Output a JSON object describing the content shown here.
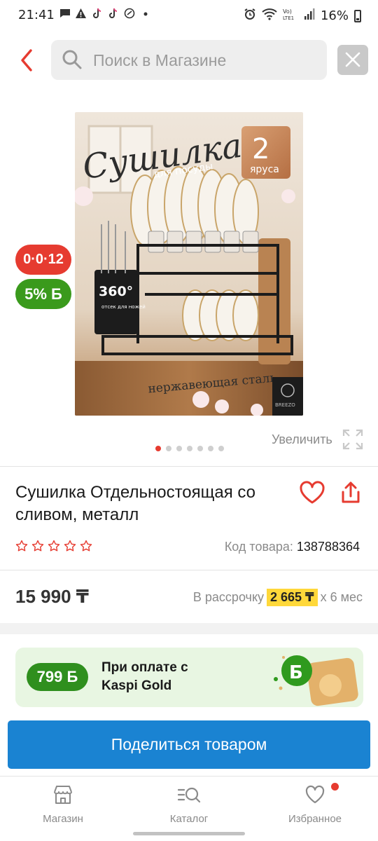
{
  "status_bar": {
    "time": "21:41",
    "battery": "16%",
    "notification_icons": [
      "chat-icon",
      "warning-icon",
      "tiktok-icon",
      "tiktok-icon",
      "sync-icon",
      "dot-icon"
    ],
    "system_icons": [
      "alarm-icon",
      "wifi-icon",
      "volte-icon",
      "signal-icon",
      "battery-icon"
    ]
  },
  "search": {
    "placeholder": "Поиск в Магазине"
  },
  "product_image": {
    "heading": "Сушилка",
    "subheading": "для посуды",
    "tier_badge_number": "2",
    "tier_badge_text": "яруса",
    "caption": "нержавеющая сталь",
    "rotate_label": "360°",
    "rotate_sub": "отсек для ножей",
    "brand": "BREEZO"
  },
  "badges": {
    "installment": "0·0·12",
    "bonus": "5% Б"
  },
  "gallery": {
    "zoom_label": "Увеличить",
    "dot_count": 7,
    "active_dot": 0
  },
  "product": {
    "title": "Сушилка Отдельностоящая со сливом, металл",
    "rating_stars": 0,
    "code_label": "Код товара:",
    "code_value": "138788364"
  },
  "pricing": {
    "price": "15 990 ₸",
    "installment_prefix": "В рассрочку",
    "installment_amount": "2 665 ₸",
    "installment_suffix": "х 6 мес"
  },
  "promo": {
    "bonus": "799 Б",
    "line1": "При оплате с",
    "line2": "Kaspi Gold"
  },
  "actions": {
    "share_label": "Поделиться товаром"
  },
  "bottom_nav": {
    "items": [
      {
        "label": "Магазин",
        "icon": "store-icon"
      },
      {
        "label": "Каталог",
        "icon": "catalog-search-icon"
      },
      {
        "label": "Избранное",
        "icon": "heart-icon"
      }
    ]
  },
  "colors": {
    "accent_red": "#e63b30",
    "accent_green": "#3a9a1c",
    "primary_blue": "#1a83d2",
    "highlight_yellow": "#ffd83a"
  }
}
